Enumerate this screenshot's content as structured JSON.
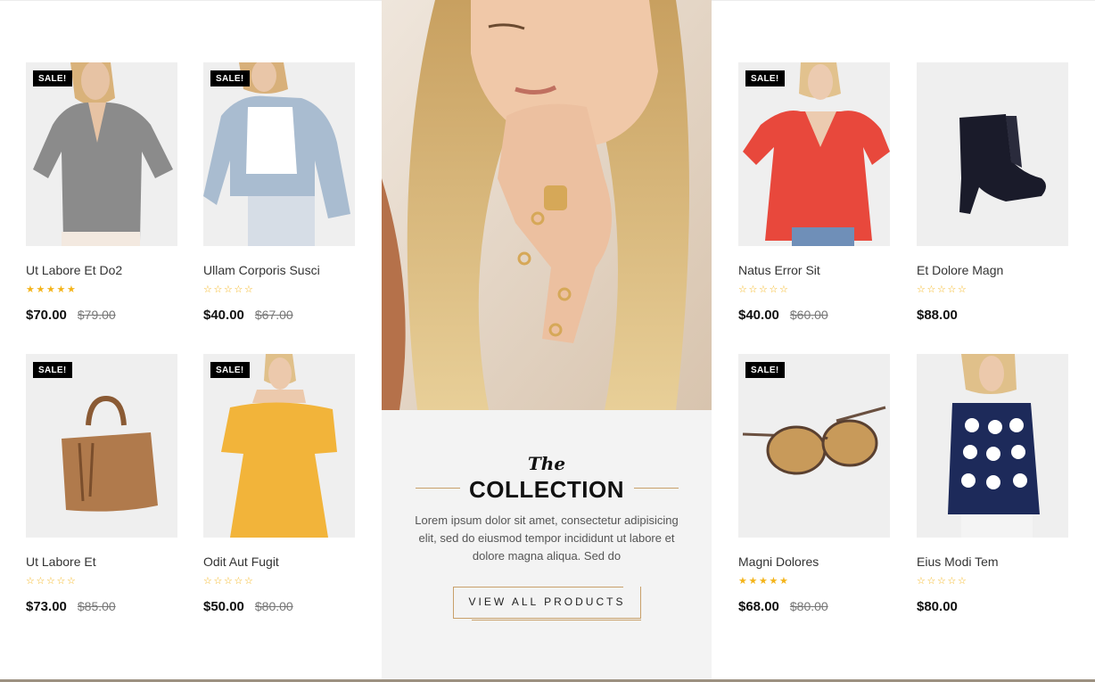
{
  "products": [
    {
      "name": "Ut Labore Et Do2",
      "price": "$70.00",
      "old_price": "$79.00",
      "sale_badge": "SALE!",
      "rating": 5
    },
    {
      "name": "Ullam Corporis Susci",
      "price": "$40.00",
      "old_price": "$67.00",
      "sale_badge": "SALE!",
      "rating": 0
    },
    {
      "name": "Natus Error Sit",
      "price": "$40.00",
      "old_price": "$60.00",
      "sale_badge": "SALE!",
      "rating": 0
    },
    {
      "name": "Et Dolore Magn",
      "price": "$88.00",
      "old_price": "",
      "sale_badge": "",
      "rating": 0
    },
    {
      "name": "Ut Labore Et",
      "price": "$73.00",
      "old_price": "$85.00",
      "sale_badge": "SALE!",
      "rating": 0
    },
    {
      "name": "Odit Aut Fugit",
      "price": "$50.00",
      "old_price": "$80.00",
      "sale_badge": "SALE!",
      "rating": 0
    },
    {
      "name": "Magni Dolores",
      "price": "$68.00",
      "old_price": "$80.00",
      "sale_badge": "SALE!",
      "rating": 5
    },
    {
      "name": "Eius Modi Tem",
      "price": "$80.00",
      "old_price": "",
      "sale_badge": "",
      "rating": 0
    }
  ],
  "collection": {
    "the": "The",
    "title": "COLLECTION",
    "description": "Lorem ipsum dolor sit amet, consectetur adipisicing elit, sed do eiusmod tempor incididunt ut labore et dolore magna aliqua. Sed do",
    "button_label": "VIEW ALL PRODUCTS"
  },
  "colors": {
    "accent": "#c8a06a",
    "star": "#f4b41a",
    "badge": "#000000"
  }
}
